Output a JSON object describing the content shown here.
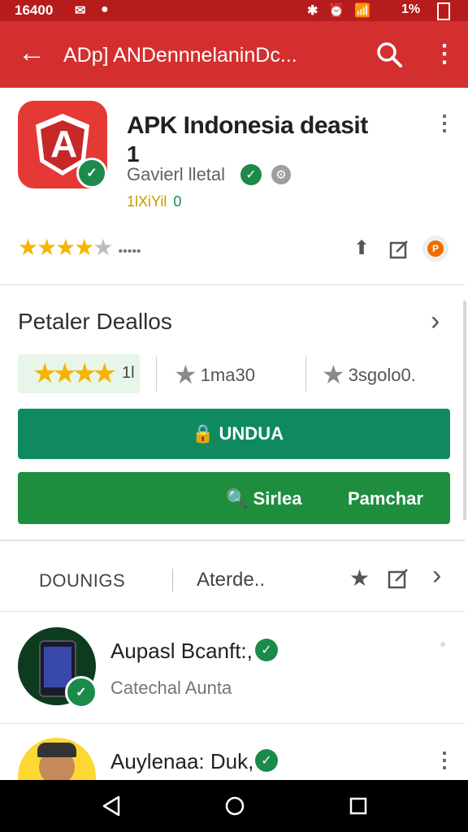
{
  "status_bar": {
    "time": "16400",
    "battery": "1%"
  },
  "app_bar": {
    "title": "ADp] ANDennnelaninDc..."
  },
  "app": {
    "title": "APK Indonesia deasit",
    "title_line2": "1",
    "developer": "Gavierl lletal",
    "small_rating": "1lXiYil",
    "small_rating_count": "0",
    "rating_count": "•••••"
  },
  "details": {
    "title": "Petaler Deallos",
    "rating_label": "1l",
    "stat2": "1ma30",
    "stat3": "3sgolo0."
  },
  "buttons": {
    "download": "UNDUA",
    "open": "Sirlea",
    "purchase": "Pamchar"
  },
  "tabs": {
    "first": "DOUNIGS",
    "second": "Aterde.."
  },
  "list": [
    {
      "name": "Aupasl Bcanft:,",
      "subtitle": "Catechal Aunta"
    },
    {
      "name": "Auylenaa: Duk,",
      "subtitle": ""
    }
  ],
  "colors": {
    "appbar": "#d32f2f",
    "statusbar": "#b71c1c",
    "primary_button": "#0f8a5f",
    "secondary_button": "#1e8e3e",
    "star": "#f4b400"
  }
}
